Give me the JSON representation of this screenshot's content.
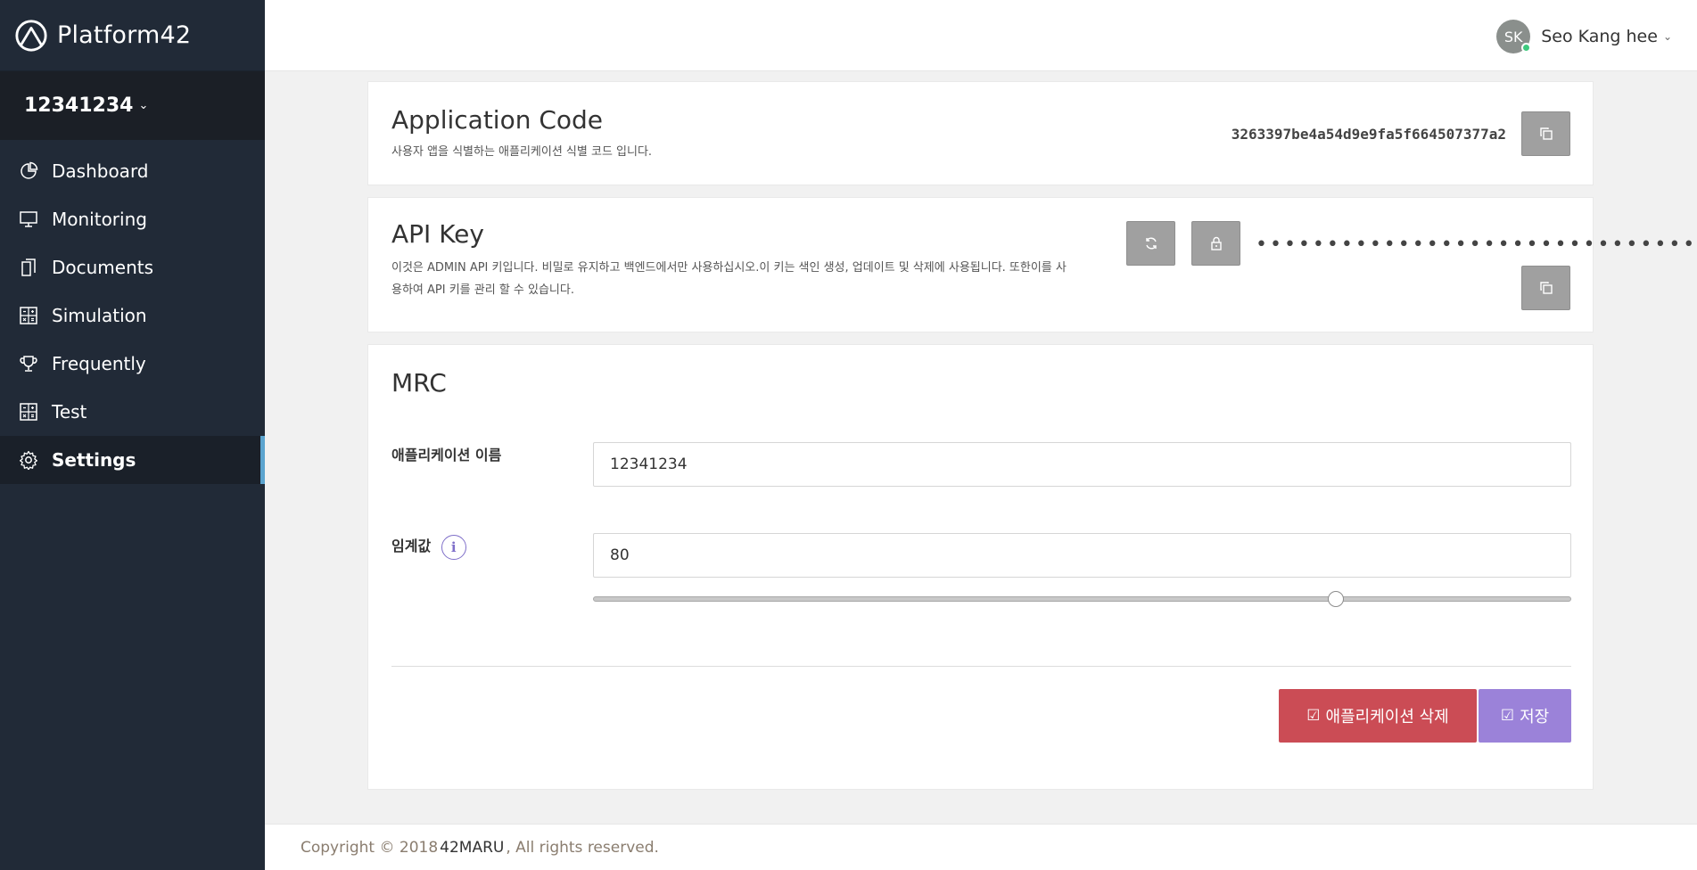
{
  "brand": {
    "name": "Platform42"
  },
  "app_switcher": {
    "name": "12341234",
    "chevron": "⌄"
  },
  "sidebar": {
    "items": [
      {
        "label": "Dashboard",
        "icon": "dashboard-icon"
      },
      {
        "label": "Monitoring",
        "icon": "monitor-icon"
      },
      {
        "label": "Documents",
        "icon": "documents-icon"
      },
      {
        "label": "Simulation",
        "icon": "calculator-icon"
      },
      {
        "label": "Frequently",
        "icon": "trophy-icon"
      },
      {
        "label": "Test",
        "icon": "calculator-icon"
      },
      {
        "label": "Settings",
        "icon": "gear-icon",
        "active": true
      }
    ]
  },
  "user": {
    "initials": "SK",
    "name": "Seo Kang hee",
    "chevron": "⌄",
    "status": "online"
  },
  "app_code": {
    "title": "Application Code",
    "description": "사용자 앱을 식별하는 애플리케이션 식별 코드 입니다.",
    "value": "3263397be4a54d9e9fa5f664507377a2"
  },
  "api_key": {
    "title": "API Key",
    "description": "이것은 ADMIN API 키입니다. 비밀로 유지하고 백엔드에서만 사용하십시오.이 키는 색인 생성, 업데이트 및 삭제에 사용됩니다. 또한이를 사용하여 API 키를 관리 할 수 있습니다.",
    "masked_value": "••••••••••••••••••••••••••••••••"
  },
  "mrc": {
    "title": "MRC",
    "app_name_label": "애플리케이션 이름",
    "app_name_value": "12341234",
    "threshold_label": "임계값",
    "threshold_value": "80",
    "threshold_fraction": 0.76,
    "delete_label": "애플리케이션 삭제",
    "save_label": "저장"
  },
  "footer": {
    "prefix": "Copyright © 2018 ",
    "company": "42MARU",
    "suffix": ", All rights reserved."
  },
  "colors": {
    "sidebar": "#212a37",
    "active_accent": "#5ba4cf",
    "danger": "#cb4c55",
    "primary": "#9b82d9"
  }
}
